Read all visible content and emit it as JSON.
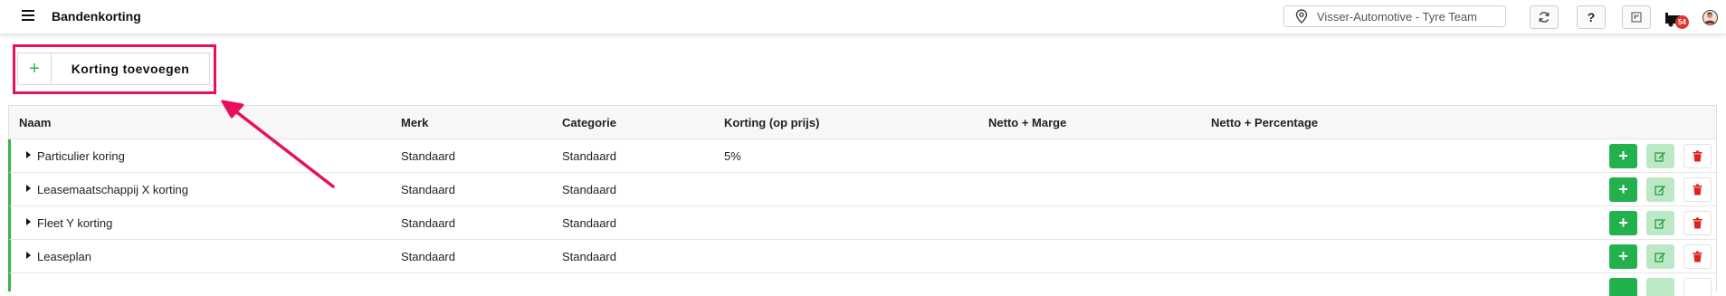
{
  "header": {
    "title": "Bandenkorting",
    "location": "Visser-Automotive - Tyre Team",
    "help_label": "?",
    "notification_count": "54"
  },
  "toolbar": {
    "add_discount_label": "Korting toevoegen"
  },
  "table": {
    "columns": [
      "Naam",
      "Merk",
      "Categorie",
      "Korting (op prijs)",
      "Netto + Marge",
      "Netto + Percentage"
    ],
    "rows": [
      {
        "naam": "Particulier koring",
        "merk": "Standaard",
        "categorie": "Standaard",
        "korting": "5%",
        "netto_marge": "",
        "netto_percentage": ""
      },
      {
        "naam": "Leasemaatschappij X korting",
        "merk": "Standaard",
        "categorie": "Standaard",
        "korting": "",
        "netto_marge": "",
        "netto_percentage": ""
      },
      {
        "naam": "Fleet Y korting",
        "merk": "Standaard",
        "categorie": "Standaard",
        "korting": "",
        "netto_marge": "",
        "netto_percentage": ""
      },
      {
        "naam": "Leaseplan",
        "merk": "Standaard",
        "categorie": "Standaard",
        "korting": "",
        "netto_marge": "",
        "netto_percentage": ""
      }
    ]
  },
  "icons": {
    "menu": "hamburger-icon",
    "location": "map-pin-icon",
    "refresh": "refresh-icon",
    "help": "question-icon",
    "calendar": "calendar-icon",
    "truck": "truck-icon",
    "avatar": "user-avatar",
    "row_add": "plus-icon",
    "row_edit": "edit-icon",
    "row_delete": "trash-icon"
  },
  "colors": {
    "accent_green": "#22b14c",
    "highlight": "#e8105c",
    "badge": "#e0342f",
    "delete_red": "#e02020"
  }
}
